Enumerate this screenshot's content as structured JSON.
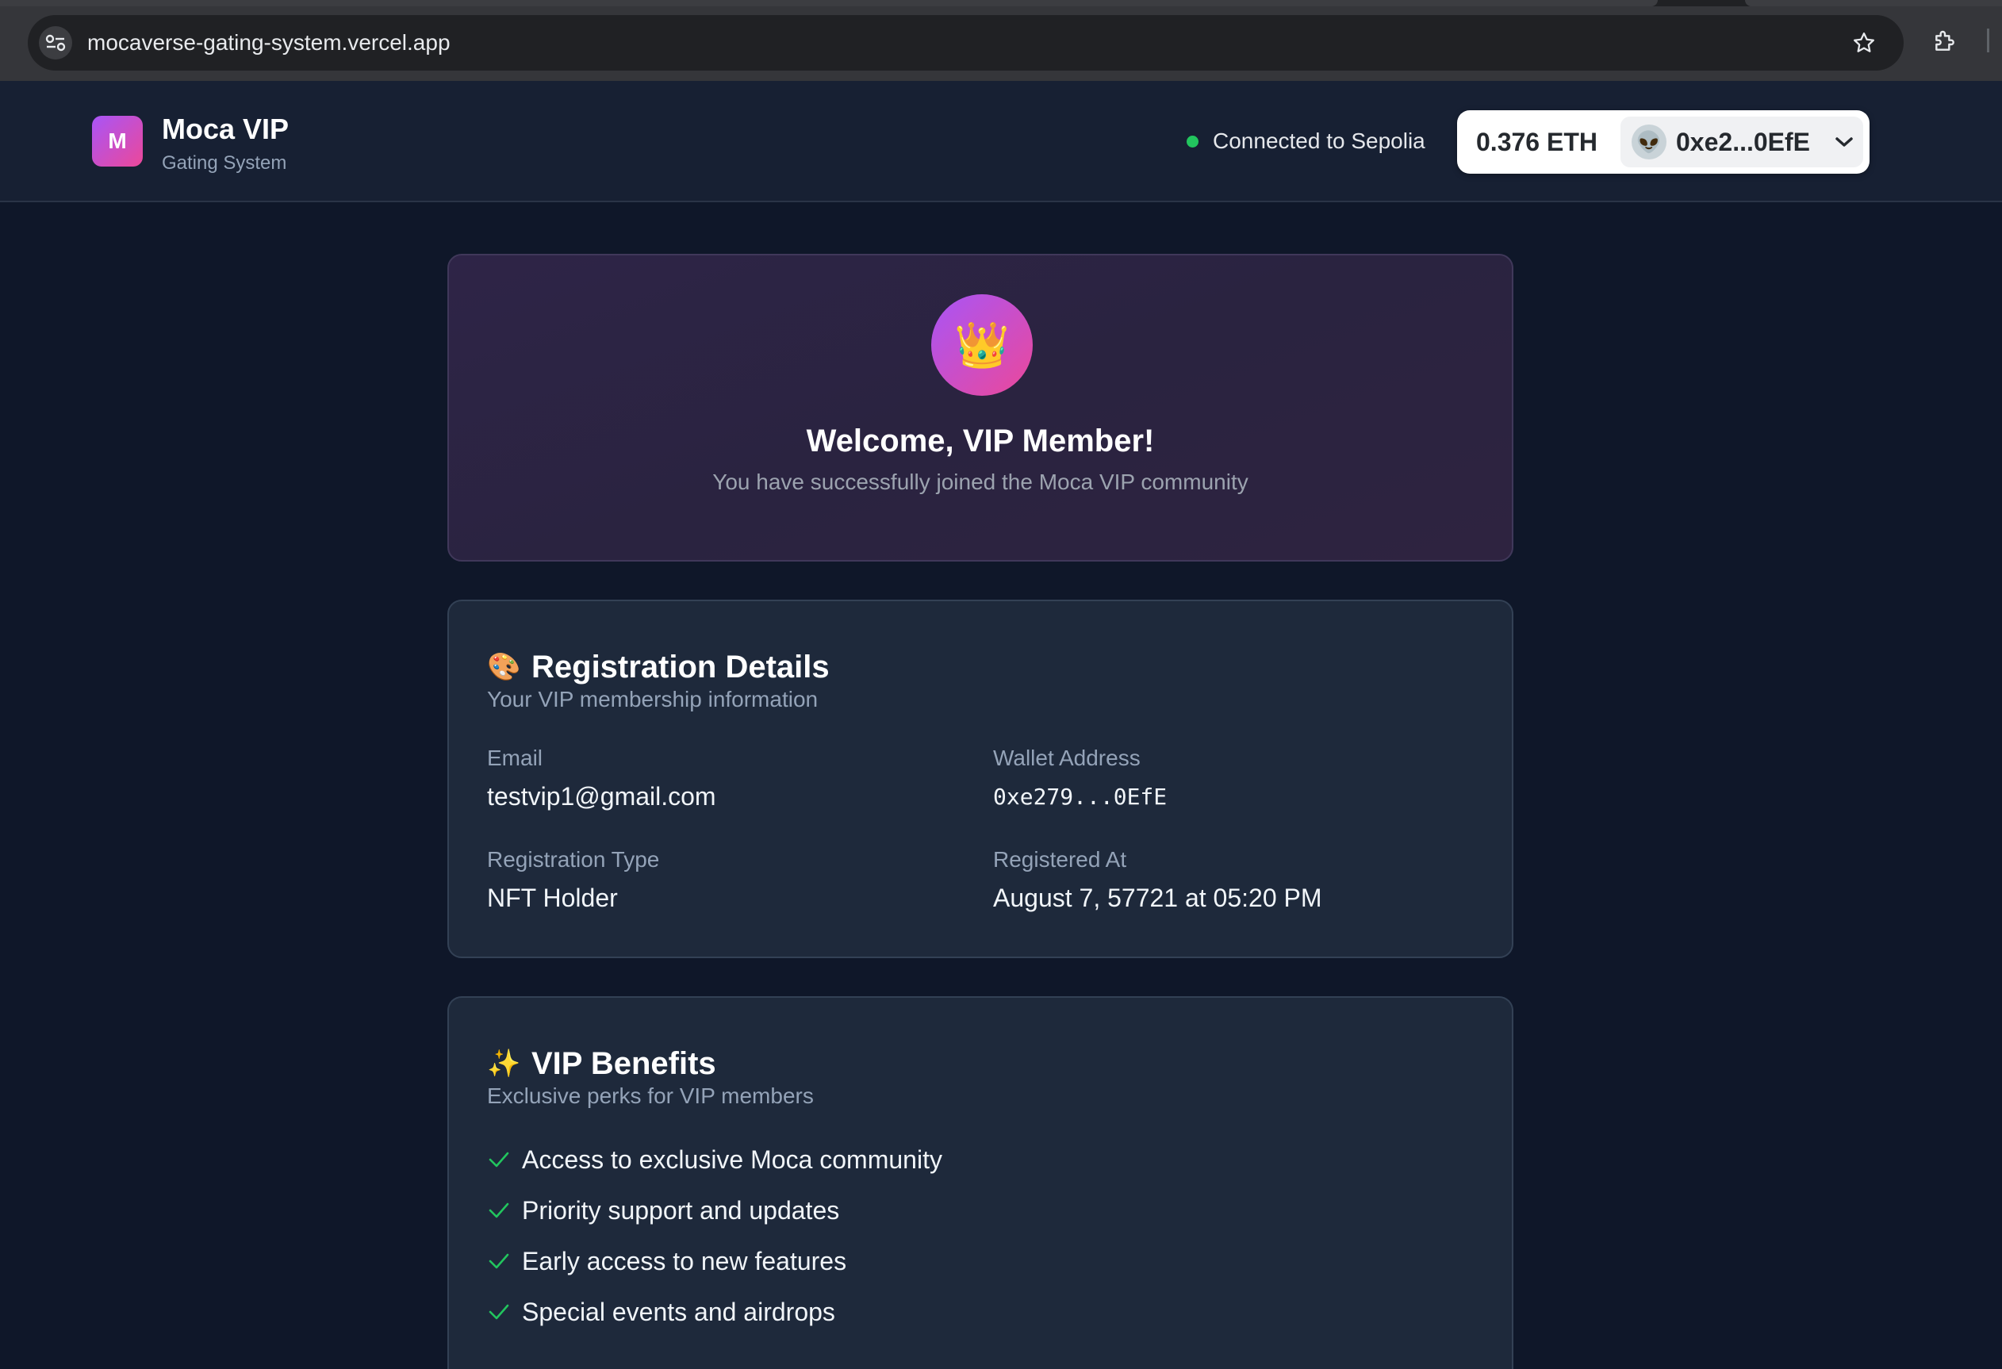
{
  "browser": {
    "url": "mocaverse-gating-system.vercel.app"
  },
  "header": {
    "logo_letter": "M",
    "brand_title": "Moca VIP",
    "brand_subtitle": "Gating System",
    "connection_status": "Connected to Sepolia",
    "status_color": "#22c55e",
    "eth_balance": "0.376 ETH",
    "account_emoji": "👽",
    "account_address": "0xe2...0EfE"
  },
  "hero": {
    "icon": "👑",
    "title": "Welcome, VIP Member!",
    "subtitle": "You have successfully joined the Moca VIP community"
  },
  "registration": {
    "icon": "🎨",
    "title": "Registration Details",
    "subtitle": "Your VIP membership information",
    "email_label": "Email",
    "email_value": "testvip1@gmail.com",
    "wallet_label": "Wallet Address",
    "wallet_value": "0xe279...0EfE",
    "type_label": "Registration Type",
    "type_value": "NFT Holder",
    "registered_label": "Registered At",
    "registered_value": "August 7, 57721 at 05:20 PM"
  },
  "benefits": {
    "icon": "✨",
    "title": "VIP Benefits",
    "subtitle": "Exclusive perks for VIP members",
    "items": [
      "Access to exclusive Moca community",
      "Priority support and updates",
      "Early access to new features",
      "Special events and airdrops"
    ],
    "check_color": "#22c55e"
  },
  "colors": {
    "page_bg": "#0f1729",
    "card_bg": "#1e293b",
    "accent_gradient_start": "#a855f7",
    "accent_gradient_end": "#ec4899"
  }
}
